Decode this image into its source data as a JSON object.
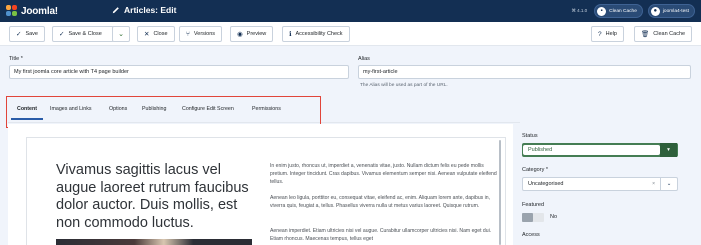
{
  "header": {
    "brand": "Joomla!",
    "title": "Articles: Edit",
    "version": "4.1.0",
    "clean_cache_btn": "Clean Cache",
    "user_btn": "joomla4-test"
  },
  "toolbar": {
    "save": "Save",
    "save_close": "Save & Close",
    "close": "Close",
    "versions": "Versions",
    "preview": "Preview",
    "accessibility": "Accessibility Check",
    "help": "Help",
    "clean_cache": "Clean Cache"
  },
  "form": {
    "title_label": "Title *",
    "title_value": "My first joomla core article with T4 page builder",
    "alias_label": "Alias",
    "alias_value": "my-first-article",
    "alias_hint": "The Alias will be used as part of the URL."
  },
  "tabs": [
    {
      "label": "Content",
      "active": true
    },
    {
      "label": "Images and Links"
    },
    {
      "label": "Options"
    },
    {
      "label": "Publishing"
    },
    {
      "label": "Configure Edit Screen"
    },
    {
      "label": "Permissions"
    }
  ],
  "editor": {
    "heading": "Vivamus sagittis lacus vel augue laoreet rutrum faucibus dolor auctor. Duis mollis, est non commodo luctus.",
    "paragraphs": [
      "In enim justo, rhoncus ut, imperdiet a, venenatis vitae, justo. Nullam dictum felis eu pede mollis pretium. Integer tincidunt. Cras dapibus. Vivamus elementum semper nisi. Aenean vulputate eleifend tellus.",
      "Aenean leo ligula, porttitor eu, consequat vitae, eleifend ac, enim. Aliquam lorem ante, dapibus in, viverra quis, feugiat a, tellus. Phasellus viverra nulla ut metus varius laoreet. Quisque rutrum.",
      "Aenean imperdiet. Etiam ultricies nisi vel augue. Curabitur ullamcorper ultricies nisi. Nam eget dui. Etiam rhoncus. Maecenas tempus, tellus eget"
    ]
  },
  "sidebar": {
    "status_label": "Status",
    "status_value": "Published",
    "category_label": "Category *",
    "category_value": "Uncategorised",
    "featured_label": "Featured",
    "featured_value": "No",
    "access_label": "Access"
  },
  "colors": {
    "header_bg": "#132f53",
    "highlight": "#e1453a",
    "published_green": "#457d54"
  }
}
